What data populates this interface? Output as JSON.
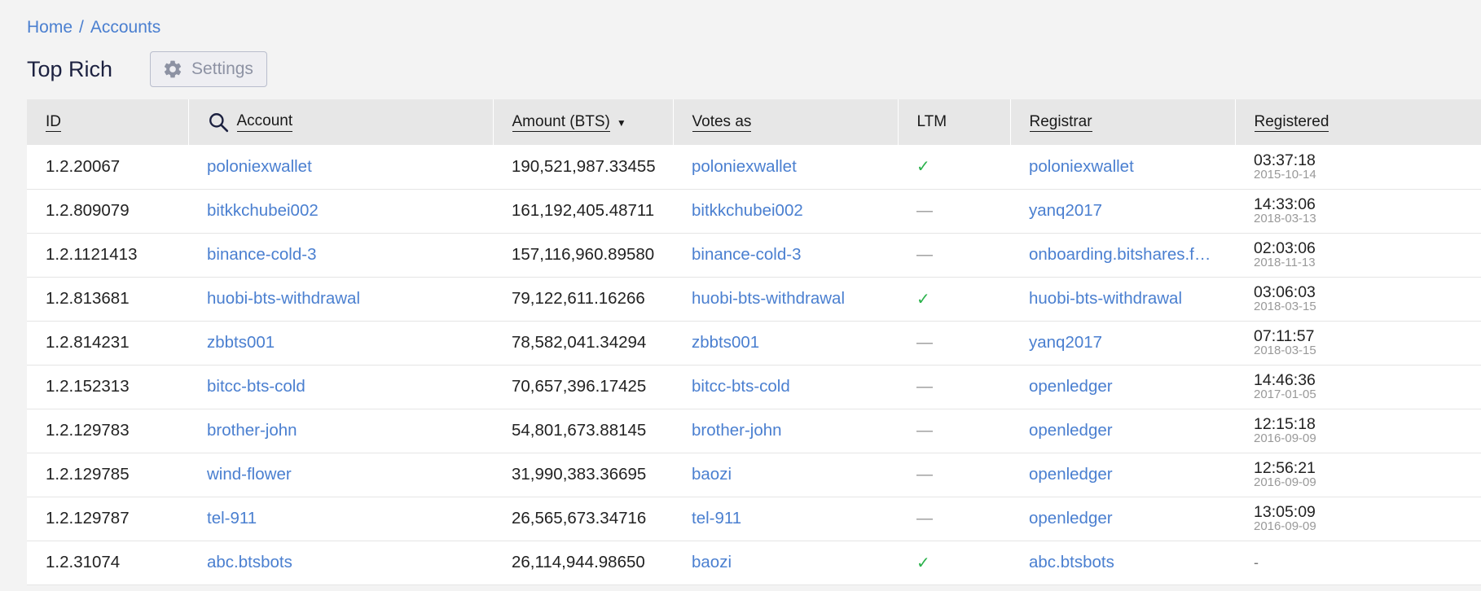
{
  "breadcrumb": {
    "home": "Home",
    "separator": "/",
    "current": "Accounts"
  },
  "page": {
    "title": "Top Rich",
    "settings_label": "Settings"
  },
  "columns": {
    "id": "ID",
    "account": "Account",
    "amount": "Amount (BTS)",
    "votes": "Votes as",
    "ltm": "LTM",
    "registrar": "Registrar",
    "registered": "Registered"
  },
  "sort": {
    "column": "amount",
    "direction": "descending",
    "indicator": "▼"
  },
  "rows": [
    {
      "id": "1.2.20067",
      "account": "poloniexwallet",
      "amount": "190,521,987.33455",
      "votes": "poloniexwallet",
      "ltm": true,
      "registrar": "poloniexwallet",
      "time": "03:37:18",
      "date": "2015-10-14"
    },
    {
      "id": "1.2.809079",
      "account": "bitkkchubei002",
      "amount": "161,192,405.48711",
      "votes": "bitkkchubei002",
      "ltm": false,
      "registrar": "yanq2017",
      "time": "14:33:06",
      "date": "2018-03-13"
    },
    {
      "id": "1.2.1121413",
      "account": "binance-cold-3",
      "amount": "157,116,960.89580",
      "votes": "binance-cold-3",
      "ltm": false,
      "registrar": "onboarding.bitshares.f…",
      "time": "02:03:06",
      "date": "2018-11-13"
    },
    {
      "id": "1.2.813681",
      "account": "huobi-bts-withdrawal",
      "amount": "79,122,611.16266",
      "votes": "huobi-bts-withdrawal",
      "ltm": true,
      "registrar": "huobi-bts-withdrawal",
      "time": "03:06:03",
      "date": "2018-03-15"
    },
    {
      "id": "1.2.814231",
      "account": "zbbts001",
      "amount": "78,582,041.34294",
      "votes": "zbbts001",
      "ltm": false,
      "registrar": "yanq2017",
      "time": "07:11:57",
      "date": "2018-03-15"
    },
    {
      "id": "1.2.152313",
      "account": "bitcc-bts-cold",
      "amount": "70,657,396.17425",
      "votes": "bitcc-bts-cold",
      "ltm": false,
      "registrar": "openledger",
      "time": "14:46:36",
      "date": "2017-01-05"
    },
    {
      "id": "1.2.129783",
      "account": "brother-john",
      "amount": "54,801,673.88145",
      "votes": "brother-john",
      "ltm": false,
      "registrar": "openledger",
      "time": "12:15:18",
      "date": "2016-09-09"
    },
    {
      "id": "1.2.129785",
      "account": "wind-flower",
      "amount": "31,990,383.36695",
      "votes": "baozi",
      "ltm": false,
      "registrar": "openledger",
      "time": "12:56:21",
      "date": "2016-09-09"
    },
    {
      "id": "1.2.129787",
      "account": "tel-911",
      "amount": "26,565,673.34716",
      "votes": "tel-911",
      "ltm": false,
      "registrar": "openledger",
      "time": "13:05:09",
      "date": "2016-09-09"
    },
    {
      "id": "1.2.31074",
      "account": "abc.btsbots",
      "amount": "26,114,944.98650",
      "votes": "baozi",
      "ltm": true,
      "registrar": "abc.btsbots",
      "time": "",
      "date": "",
      "registered_placeholder": "-"
    }
  ],
  "ltm_symbols": {
    "yes": "✓",
    "no": "—"
  },
  "icons": {
    "settings": "gear-icon",
    "search": "search-icon",
    "sort": "sort-desc-icon",
    "check": "check-icon",
    "dash": "dash-icon"
  },
  "colors": {
    "link": "#4a7fd0",
    "check": "#2bb24c",
    "title": "#1c2140",
    "header_bg": "#e7e7e7"
  }
}
